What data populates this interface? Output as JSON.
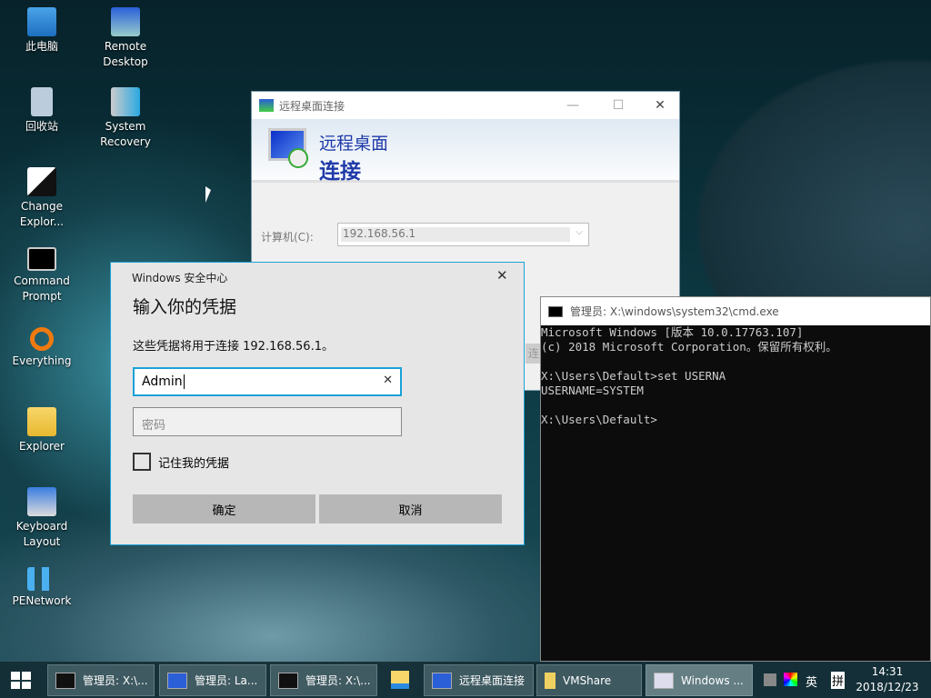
{
  "desktop_icons": [
    {
      "label": "此电脑",
      "icon": "computer-icon"
    },
    {
      "label": "Remote Desktop",
      "icon": "remote-desktop-icon"
    },
    {
      "label": "回收站",
      "icon": "recycle-bin-icon"
    },
    {
      "label": "System Recovery",
      "icon": "system-recovery-icon"
    },
    {
      "label": "Change Explor...",
      "icon": "change-explorer-icon"
    },
    {
      "label": "Command Prompt",
      "icon": "command-prompt-icon"
    },
    {
      "label": "Everything",
      "icon": "search-icon"
    },
    {
      "label": "Explorer",
      "icon": "folder-icon"
    },
    {
      "label": "Keyboard Layout",
      "icon": "keyboard-icon"
    },
    {
      "label": "PENetwork",
      "icon": "network-icon"
    }
  ],
  "rdp": {
    "title": "远程桌面连接",
    "banner_line1": "远程桌面",
    "banner_line2": "连接",
    "computer_label": "计算机(C):",
    "computer_value": "192.168.56.1",
    "connect_partial": "连"
  },
  "security": {
    "title": "Windows 安全中心",
    "heading": "输入你的凭据",
    "description": "这些凭据将用于连接 192.168.56.1。",
    "username": "Admin",
    "password_placeholder": "密码",
    "remember": "记住我的凭据",
    "ok": "确定",
    "cancel": "取消"
  },
  "cmd": {
    "title": "管理员: X:\\windows\\system32\\cmd.exe",
    "output": "Microsoft Windows [版本 10.0.17763.107]\n(c) 2018 Microsoft Corporation。保留所有权利。\n\nX:\\Users\\Default>set USERNA\nUSERNAME=SYSTEM\n\nX:\\Users\\Default>"
  },
  "taskbar": {
    "items": [
      "管理员: X:\\...",
      "管理员: La...",
      "管理员: X:\\...",
      "",
      "远程桌面连接",
      "VMShare",
      "Windows ..."
    ],
    "ime": "英",
    "ime2": "拼",
    "time": "14:31",
    "date": "2018/12/23"
  }
}
